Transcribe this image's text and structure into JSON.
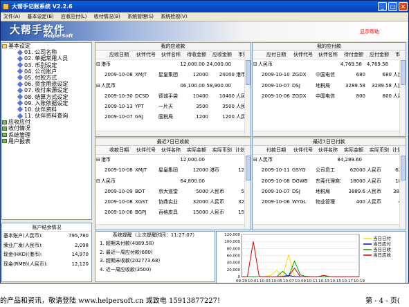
{
  "window": {
    "title": "大帮手记账系统  V2.2.6"
  },
  "menu": [
    "文件(A)",
    "基本设定(B)",
    "应收应付(L)",
    "收付情况(B)",
    "系统管理(S)",
    "系统检视(V)"
  ],
  "banner": {
    "logo": "大帮手软件",
    "sub": "HelperSoft",
    "help": "显示帮助"
  },
  "tree": {
    "root": "基本设定",
    "items": [
      "01. 公司名称",
      "02. 单据常用人员",
      "03. 币别设定",
      "04. 公司账户",
      "05. 付款方式",
      "06. 资金用途设定",
      "07. 收付来源设定",
      "08. 结算方式设定",
      "09. 入账依据设定",
      "10. 伙伴资料",
      "11. 伙伴资料查询"
    ],
    "others": [
      "应收应付",
      "收付情况",
      "系统管理",
      "用户报表"
    ]
  },
  "receivable": {
    "title": "我的应收款",
    "headers": [
      "应收日期",
      "伙伴代号",
      "伙伴名称",
      "待收金额",
      "应收金额",
      "币别"
    ],
    "groups": [
      {
        "name": "港币",
        "total": [
          "12,000.00",
          "24,000.00"
        ],
        "rows": [
          [
            "2009-10-08",
            "XMJT",
            "星皇集团",
            "12000",
            "24000",
            "港币"
          ]
        ]
      },
      {
        "name": "人民币",
        "total": [
          "06,100.00",
          "58,900.00"
        ],
        "rows": [
          [
            "2009-10-30",
            "DCSD",
            "德诚手袋",
            "10400",
            "10400",
            "人民币"
          ],
          [
            "2009-10-13",
            "YPT",
            "一片天",
            "3500",
            "3500",
            "人民币"
          ],
          [
            "2009-10-07",
            "GSJ",
            "国税局",
            "1200",
            "1200",
            "人民币"
          ]
        ]
      }
    ]
  },
  "payable": {
    "title": "我的应付款",
    "headers": [
      "应付日期",
      "伙伴代号",
      "伙伴名称",
      "待付金额",
      "应付金额",
      "币别"
    ],
    "groups": [
      {
        "name": "人民币",
        "total": [
          "4,769.58",
          "4,769.58"
        ],
        "rows": [
          [
            "2009-10-10",
            "ZGDX",
            "中国电信",
            "680",
            "680",
            "人民币"
          ],
          [
            "2009-10-07",
            "DSJ",
            "地税局",
            "3289.58",
            "3289.58",
            "人民币"
          ],
          [
            "2009-10-06",
            "ZGDX",
            "中国电信",
            "800",
            "800",
            "人民币"
          ]
        ]
      }
    ]
  },
  "recent_received": {
    "title": "最近7日已收款",
    "headers": [
      "收款日期",
      "伙伴代号",
      "伙伴名称",
      "实际金额",
      "实际币别",
      "计划"
    ],
    "groups": [
      {
        "name": "港币",
        "total": "12,000.00",
        "rows": [
          [
            "2009-10-08",
            "XMJT",
            "星皇集团",
            "12000",
            "港币",
            "12"
          ]
        ]
      },
      {
        "name": "人民币",
        "total": "64,800.00",
        "rows": [
          [
            "2009-10-09",
            "BDT",
            "京大道堂",
            "5000",
            "人民币",
            "5"
          ],
          [
            "2009-10-08",
            "XGST",
            "协鼎实业",
            "32000",
            "人民币",
            "32"
          ],
          [
            "2009-10-06",
            "BGPJ",
            "百格皮具",
            "15000",
            "人民币",
            "15"
          ]
        ]
      }
    ]
  },
  "recent_paid": {
    "title": "最近7日已付款",
    "headers": [
      "付款日期",
      "伙伴代号",
      "伙伴名称",
      "实际金额",
      "实际币别",
      "计划"
    ],
    "groups": [
      {
        "name": "人民币",
        "total": "84,289.60",
        "rows": [
          [
            "2009-10-11",
            "GSYG",
            "公司员工",
            "62000",
            "人民币",
            "62"
          ],
          [
            "2009-10-08",
            "DGWB",
            "东莞代理商1",
            "18000",
            "人民币",
            "18"
          ],
          [
            "2009-10-07",
            "DSJ",
            "地税局",
            "3889.6",
            "人民币",
            "388"
          ],
          [
            "2009-10-06",
            "WYGL",
            "物业管理",
            "400",
            "人民币",
            "4"
          ]
        ]
      }
    ]
  },
  "accounts": {
    "title": "账户结余情况",
    "items": [
      {
        "label": "基本账户(人民币):",
        "value": "795,780"
      },
      {
        "label": "荣业广发(人民币):",
        "value": "2,098"
      },
      {
        "label": "现金(HKD)(港币):",
        "value": "14,970"
      },
      {
        "label": "现金(RMB)(人民币):",
        "value": "12,120"
      }
    ]
  },
  "reminder": {
    "title": "系统提醒（上次提醒时间：11:27:07）",
    "items": [
      "1. 超期未付款(4089.58)",
      "2. 最近一周应付款(680)",
      "3. 超期未收款(202773.68)",
      "4. 近一周应收款(3500)"
    ]
  },
  "chart_data": {
    "type": "line",
    "x": [
      "09-29",
      "10-01",
      "10-03",
      "10-05",
      "10-07",
      "10-09",
      "10-11",
      "10-13",
      "10-15",
      "10-17",
      "10-19"
    ],
    "ylim": [
      0,
      120000
    ],
    "yticks": [
      "120,000",
      "100,000",
      "80,000",
      "60,000",
      "40,000",
      "20,000",
      "0"
    ],
    "series": [
      {
        "name": "当日已付",
        "color": "#ffd800",
        "values": [
          0,
          0,
          0,
          0,
          400,
          3889.6,
          18000,
          0,
          62000,
          0,
          0,
          0,
          0,
          0,
          0,
          0,
          0,
          0,
          0,
          0,
          0
        ]
      },
      {
        "name": "当日应付",
        "color": "#0000cc",
        "values": [
          0,
          0,
          0,
          0,
          0,
          0,
          0,
          800,
          3289.58,
          0,
          0,
          680,
          0,
          0,
          0,
          0,
          0,
          0,
          0,
          0,
          0
        ]
      },
      {
        "name": "当日已收",
        "color": "#00a000",
        "values": [
          0,
          0,
          0,
          0,
          0,
          0,
          0,
          15000,
          0,
          44000,
          5000,
          0,
          0,
          0,
          0,
          0,
          0,
          0,
          0,
          0,
          0
        ]
      },
      {
        "name": "当日应收",
        "color": "#cc0000",
        "values": [
          0,
          0,
          100000,
          0,
          0,
          0,
          0,
          0,
          1200,
          24000,
          0,
          0,
          0,
          0,
          3500,
          0,
          0,
          0,
          0,
          0,
          0
        ]
      }
    ]
  },
  "footer": {
    "left": "的产品和资讯，敬请登陆 www.helpersoft.cn 或致电 15913877227!",
    "right": "第 - 4 - 页("
  }
}
